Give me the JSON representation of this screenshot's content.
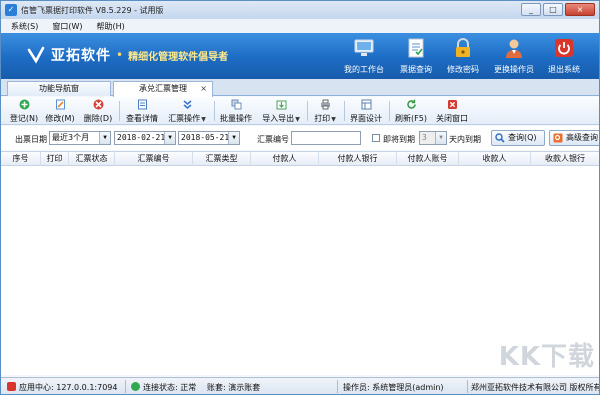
{
  "window": {
    "title": "信管飞票据打印软件 V8.5.229 - 试用版",
    "controls": [
      "_",
      "□",
      "×"
    ]
  },
  "menu": [
    "系统(S)",
    "窗口(W)",
    "帮助(H)"
  ],
  "banner": {
    "brand": "亚拓软件",
    "slogan": "精细化管理软件倡导者",
    "buttons": [
      {
        "label": "我的工作台",
        "icon": "monitor-icon"
      },
      {
        "label": "票据查询",
        "icon": "document-icon"
      },
      {
        "label": "修改密码",
        "icon": "lock-icon"
      },
      {
        "label": "更换操作员",
        "icon": "user-icon"
      },
      {
        "label": "退出系统",
        "icon": "power-icon"
      }
    ]
  },
  "tabs": [
    {
      "label": "功能导航窗",
      "active": false
    },
    {
      "label": "承兑汇票管理",
      "active": true,
      "close": "×"
    }
  ],
  "toolbar": [
    {
      "label": "登记(N)",
      "icon": "add-icon",
      "color": "#2fa84f"
    },
    {
      "label": "修改(M)",
      "icon": "edit-icon",
      "color": "#5b8fd6"
    },
    {
      "label": "删除(D)",
      "icon": "delete-icon",
      "color": "#d64238"
    },
    {
      "label": "查看详情",
      "icon": "view-icon",
      "color": "#4a7fc4"
    },
    {
      "label": "汇票操作",
      "icon": "operation-icon",
      "color": "#3a78c9",
      "dropdown": true
    },
    {
      "label": "批量操作",
      "icon": "batch-icon",
      "color": "#6e8fb8"
    },
    {
      "label": "导入导出",
      "icon": "import-export-icon",
      "color": "#4aa35a",
      "dropdown": true
    },
    {
      "label": "打印",
      "icon": "print-icon",
      "color": "#666",
      "dropdown": true
    },
    {
      "label": "界面设计",
      "icon": "design-icon",
      "color": "#5d7fb0"
    },
    {
      "label": "刷新(F5)",
      "icon": "refresh-icon",
      "color": "#3c9a4a"
    },
    {
      "label": "关闭窗口",
      "icon": "close-window-icon",
      "color": "#d23b2f"
    }
  ],
  "filter": {
    "date_label": "出票日期",
    "range_value": "最近3个月",
    "date_from": "2018-02-21",
    "date_to": "2018-05-21",
    "bill_no_label": "汇票编号",
    "bill_no_value": "",
    "due_checkbox_label": "即将到期",
    "due_days": "3",
    "due_suffix": "天内到期",
    "query_button": "查询(Q)",
    "advanced_button": "高级查询"
  },
  "grid": {
    "columns": [
      "序号",
      "打印",
      "汇票状态",
      "汇票编号",
      "汇票类型",
      "付款人",
      "付款人银行",
      "付款人账号",
      "收款人",
      "收款人银行"
    ],
    "rows": []
  },
  "watermark": "KK下载",
  "status": {
    "app_center": "应用中心: 127.0.0.1:7094",
    "connection": "连接状态: 正常",
    "account": "账套: 演示账套",
    "operator": "操作员: 系统管理员(admin)",
    "company": "郑州亚拓软件技术有限公司 版权所有"
  }
}
